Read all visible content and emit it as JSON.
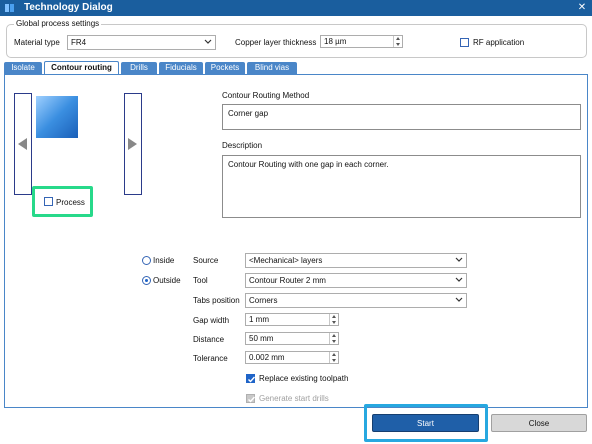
{
  "window": {
    "title": "Technology Dialog",
    "close_glyph": "✕"
  },
  "global": {
    "group_title": "Global process settings",
    "material_label": "Material type",
    "material_value": "FR4",
    "copper_label": "Copper layer thickness",
    "copper_value": "18 µm",
    "rf_label": "RF application",
    "rf_checked": false
  },
  "tabs": [
    {
      "label": "Isolate",
      "active": false
    },
    {
      "label": "Contour routing",
      "active": true
    },
    {
      "label": "Drills",
      "active": false
    },
    {
      "label": "Fiducials",
      "active": false
    },
    {
      "label": "Pockets",
      "active": false
    },
    {
      "label": "Blind vias",
      "active": false
    }
  ],
  "left_panel": {
    "process_label": "Process",
    "process_checked": false
  },
  "method": {
    "label": "Contour Routing Method",
    "value": "Corner gap"
  },
  "description": {
    "label": "Description",
    "value": "Contour Routing with one gap in each corner."
  },
  "side": {
    "inside_label": "Inside",
    "outside_label": "Outside",
    "selected": "Outside"
  },
  "form": {
    "source_label": "Source",
    "source_value": "<Mechanical> layers",
    "tool_label": "Tool",
    "tool_value": "Contour Router 2 mm",
    "tabs_position_label": "Tabs position",
    "tabs_position_value": "Corners",
    "gap_width_label": "Gap width",
    "gap_width_value": "1 mm",
    "distance_label": "Distance",
    "distance_value": "50 mm",
    "tolerance_label": "Tolerance",
    "tolerance_value": "0.002 mm",
    "replace_label": "Replace existing toolpath",
    "replace_checked": true,
    "generate_label": "Generate start drills",
    "generate_checked": true,
    "generate_disabled": true
  },
  "buttons": {
    "start_label": "Start",
    "close_label": "Close"
  },
  "colors": {
    "titlebar": "#1a5e9e",
    "tab": "#4a86c8",
    "highlight_green": "#27d98a",
    "highlight_blue": "#27a8e0"
  }
}
